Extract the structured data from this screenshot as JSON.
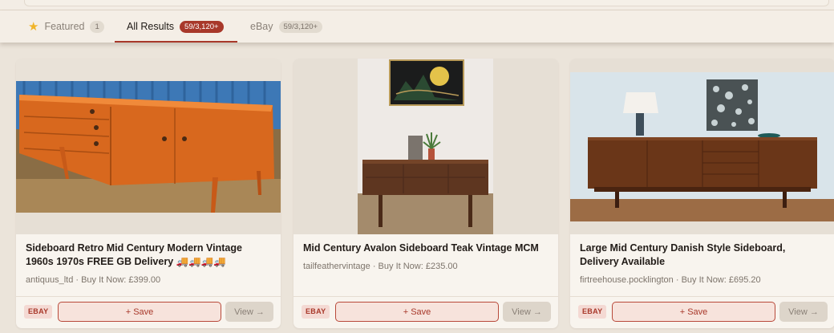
{
  "tabs": [
    {
      "label": "Featured",
      "count": "1",
      "icon": "star-icon"
    },
    {
      "label": "All Results",
      "count": "59/3,120+"
    },
    {
      "label": "eBay",
      "count": "59/3,120+"
    }
  ],
  "colors": {
    "accent": "#a8382a",
    "background": "#ebe4da",
    "card": "#f8f4ee"
  },
  "results": [
    {
      "title": "Sideboard Retro Mid Century Modern Vintage 1960s 1970s FREE GB Delivery 🚚🚚🚚🚚",
      "meta": "antiquus_ltd · Buy It Now: £399.00",
      "source": "EBAY",
      "save_label": "+ Save",
      "view_label": "View →"
    },
    {
      "title": "Mid Century Avalon Sideboard Teak Vintage MCM",
      "meta": "tailfeathervintage · Buy It Now: £235.00",
      "source": "EBAY",
      "save_label": "+ Save",
      "view_label": "View →"
    },
    {
      "title": "Large Mid Century Danish Style Sideboard, Delivery Available",
      "meta": "firtreehouse.pocklington · Buy It Now: £695.20",
      "source": "EBAY",
      "save_label": "+ Save",
      "view_label": "View →"
    }
  ]
}
